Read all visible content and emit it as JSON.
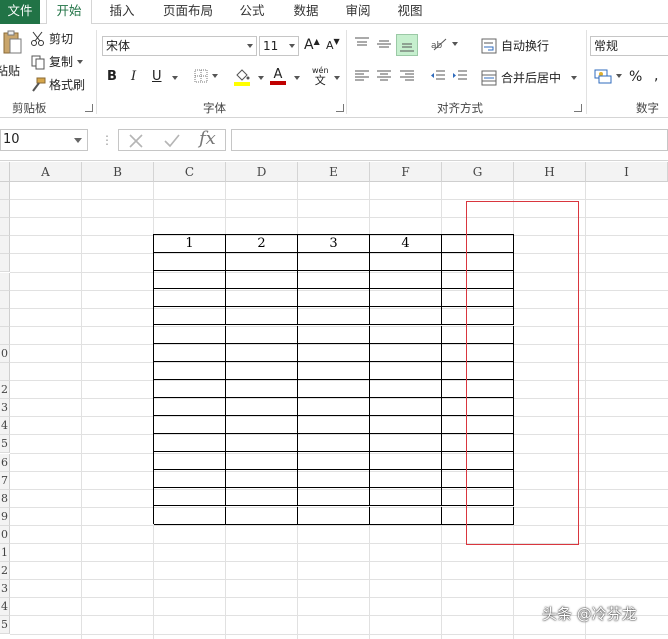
{
  "tabs": [
    "文件",
    "开始",
    "插入",
    "页面布局",
    "公式",
    "数据",
    "审阅",
    "视图"
  ],
  "clipboard": {
    "paste_label": "粘贴",
    "cut_label": "剪切",
    "copy_label": "复制",
    "format_painter_label": "格式刷",
    "group_label": "剪贴板"
  },
  "font": {
    "name": "宋体",
    "size": "11",
    "grow_label": "A",
    "shrink_label": "A",
    "bold_label": "B",
    "italic_label": "I",
    "underline_label": "U",
    "phonetic_label": "wén",
    "phonetic_char": "文",
    "group_label": "字体",
    "highlight_color": "#ffff00",
    "font_color": "#c00000"
  },
  "alignment": {
    "wrap_text_label": "自动换行",
    "merge_center_label": "合并后居中",
    "group_label": "对齐方式"
  },
  "number": {
    "format": "常规",
    "percent_label": "%",
    "group_label": "数字"
  },
  "formula_bar": {
    "name_box": "10",
    "fx_label": "fx",
    "formula": ""
  },
  "columns": [
    "A",
    "B",
    "C",
    "D",
    "E",
    "F",
    "G",
    "H",
    "I"
  ],
  "row_labels": [
    "",
    "",
    "",
    "",
    "",
    "",
    "",
    "",
    "",
    "0",
    "",
    "2",
    "3",
    "4",
    "5",
    "6",
    "7",
    "8",
    "9",
    "0",
    "1",
    "2",
    "3",
    "4",
    "5"
  ],
  "table": {
    "header": [
      "1",
      "2",
      "3",
      "4",
      ""
    ],
    "body_rows": 15
  },
  "watermark": "头条 @冷芬龙"
}
